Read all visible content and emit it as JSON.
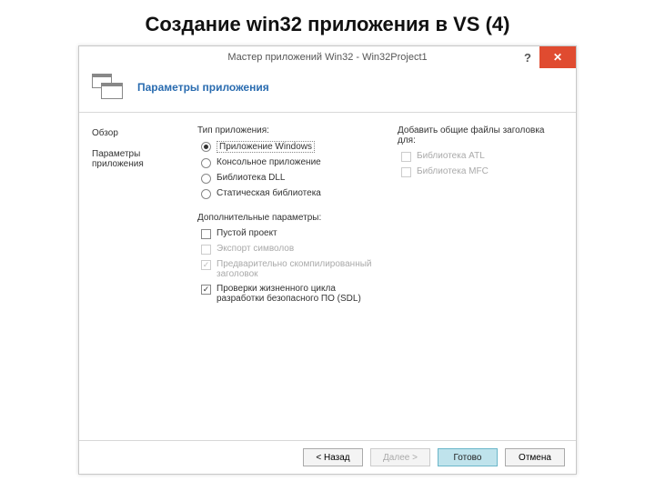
{
  "slide": {
    "title": "Создание win32 приложения в VS (4)"
  },
  "window": {
    "title": "Мастер приложений Win32 - Win32Project1",
    "header_title": "Параметры приложения"
  },
  "sidebar": {
    "items": [
      {
        "label": "Обзор"
      },
      {
        "label": "Параметры приложения"
      }
    ]
  },
  "appType": {
    "group_label": "Тип приложения:",
    "options": [
      {
        "label": "Приложение Windows",
        "selected": true
      },
      {
        "label": "Консольное приложение",
        "selected": false
      },
      {
        "label": "Библиотека DLL",
        "selected": false
      },
      {
        "label": "Статическая библиотека",
        "selected": false
      }
    ]
  },
  "extraParams": {
    "group_label": "Дополнительные параметры:",
    "options": [
      {
        "label": "Пустой проект",
        "checked": false,
        "disabled": false
      },
      {
        "label": "Экспорт символов",
        "checked": false,
        "disabled": true
      },
      {
        "label": "Предварительно скомпилированный заголовок",
        "checked": true,
        "disabled": true
      },
      {
        "label": "Проверки жизненного цикла разработки безопасного ПО (SDL)",
        "checked": true,
        "disabled": false
      }
    ]
  },
  "commonHeaders": {
    "group_label": "Добавить общие файлы заголовка для:",
    "options": [
      {
        "label": "Библиотека ATL",
        "checked": false,
        "disabled": true
      },
      {
        "label": "Библиотека MFC",
        "checked": false,
        "disabled": true
      }
    ]
  },
  "footer": {
    "back": "< Назад",
    "next": "Далее >",
    "finish": "Готово",
    "cancel": "Отмена"
  }
}
